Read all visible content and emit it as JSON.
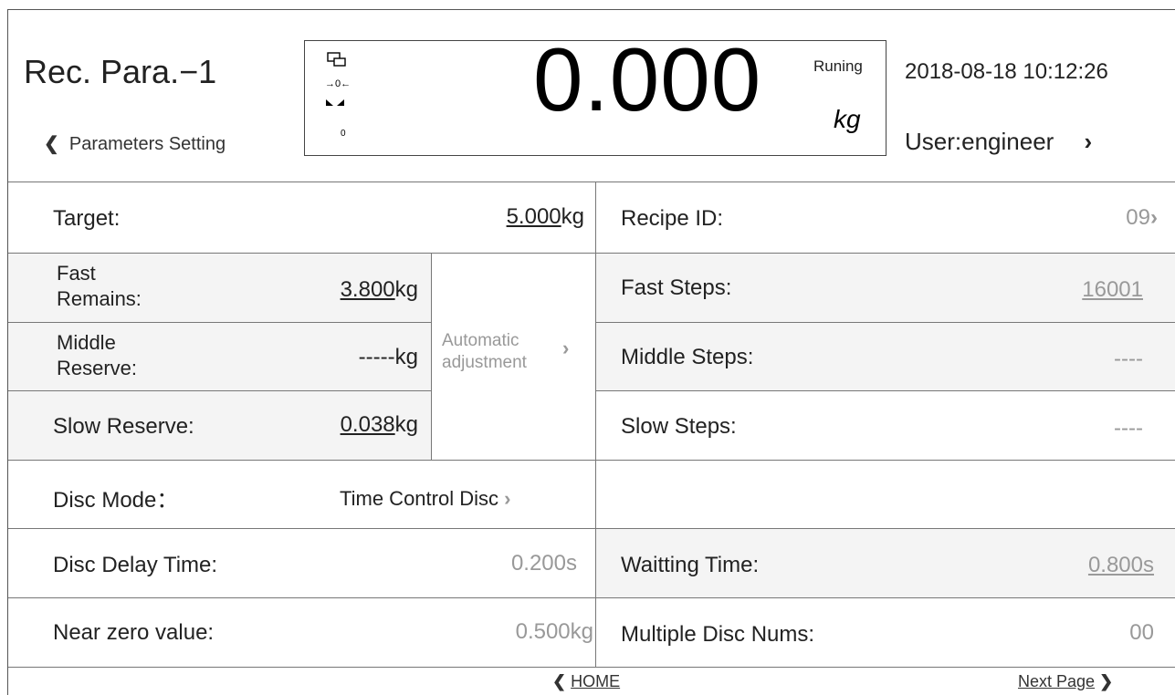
{
  "header": {
    "title": "Rec. Para.−1",
    "back_label": "Parameters Setting",
    "back_chevron": "❮",
    "display": {
      "weight": "0.000",
      "unit": "kg",
      "status": "Runing",
      "zero_indicator": "→0←",
      "small_value": "0"
    },
    "datetime": "2018-08-18 10:12:26",
    "user": "User:engineer",
    "user_chevron": "›"
  },
  "params": {
    "target": {
      "label": "Target:",
      "value": "5.000",
      "unit": "kg"
    },
    "recipe_id": {
      "label": "Recipe ID:",
      "value": "09",
      "chevron": "›"
    },
    "fast_remains": {
      "label_line1": "Fast",
      "label_line2": "Remains:",
      "value": "3.800",
      "unit": "kg"
    },
    "fast_steps": {
      "label": "Fast Steps:",
      "value": "16001"
    },
    "middle_reserve": {
      "label_line1": "Middle",
      "label_line2": "Reserve:",
      "value": "-----",
      "unit": "kg"
    },
    "middle_steps": {
      "label": "Middle Steps:",
      "value": "----"
    },
    "slow_reserve": {
      "label": "Slow Reserve:",
      "value": "0.038",
      "unit": "kg"
    },
    "slow_steps": {
      "label": "Slow Steps:",
      "value": "----"
    },
    "auto_adjust": {
      "line1": "Automatic",
      "line2": "adjustment",
      "chevron": "›"
    },
    "disc_mode": {
      "label": "Disc  Mode：",
      "value": "Time Control Disc",
      "chevron": "›"
    },
    "disc_delay": {
      "label": "Disc Delay Time:",
      "value": "0.200s"
    },
    "waiting_time": {
      "label": "Waitting Time:",
      "value": "0.800s"
    },
    "near_zero": {
      "label": "Near zero value:",
      "value": "0.500kg"
    },
    "multiple_disc": {
      "label": "Multiple Disc Nums:",
      "value": "00"
    }
  },
  "footer": {
    "home_chevron": "❮",
    "home_label": "HOME",
    "next_label": "Next Page",
    "next_chevron": "❯"
  }
}
